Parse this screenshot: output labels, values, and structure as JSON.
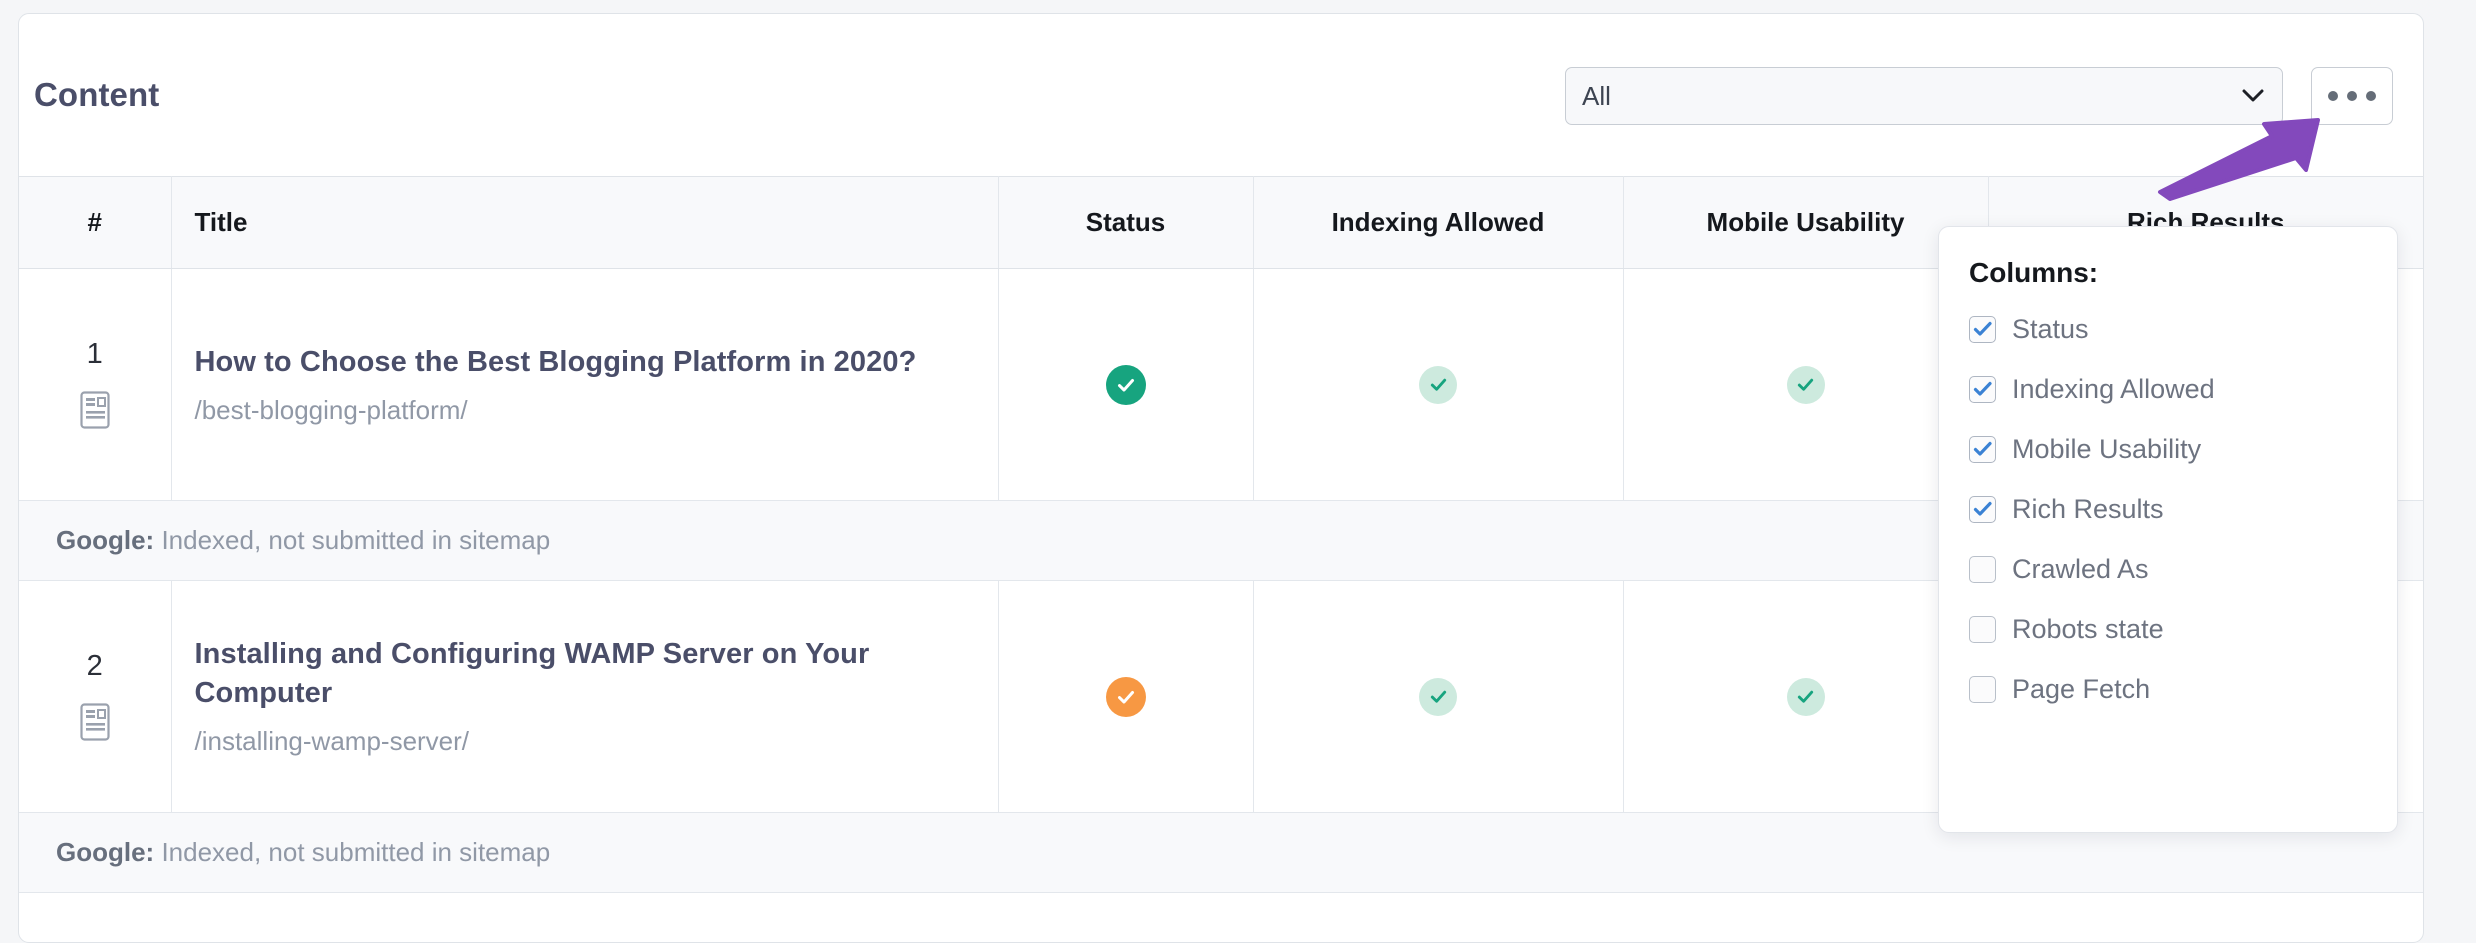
{
  "card": {
    "title": "Content",
    "filter": {
      "selected": "All",
      "chevron_icon": "chevron-down-icon"
    },
    "more_button": {
      "icon": "ellipsis-icon",
      "label": "•••"
    }
  },
  "table": {
    "headers": {
      "number": "#",
      "title": "Title",
      "status": "Status",
      "indexing_allowed": "Indexing Allowed",
      "mobile_usability": "Mobile Usability",
      "rich_results": "Rich Results"
    },
    "rows": [
      {
        "number": "1",
        "type_icon": "article-icon",
        "title": "How to Choose the Best Blogging Platform in 2020?",
        "url": "/best-blogging-platform/",
        "status_icon": "check-circle-solid-green",
        "indexing_icon": "check-circle-soft-green",
        "mobile_icon": "check-circle-soft-green",
        "note_label": "Google:",
        "note_text": " Indexed, not submitted in sitemap"
      },
      {
        "number": "2",
        "type_icon": "article-icon",
        "title": "Installing and Configuring WAMP Server on Your Computer",
        "url": "/installing-wamp-server/",
        "status_icon": "check-circle-solid-orange",
        "indexing_icon": "check-circle-soft-green",
        "mobile_icon": "check-circle-soft-green",
        "note_label": "Google:",
        "note_text": " Indexed, not submitted in sitemap"
      }
    ]
  },
  "columns_panel": {
    "title": "Columns:",
    "options": [
      {
        "label": "Status",
        "checked": true
      },
      {
        "label": "Indexing Allowed",
        "checked": true
      },
      {
        "label": "Mobile Usability",
        "checked": true
      },
      {
        "label": "Rich Results",
        "checked": true
      },
      {
        "label": "Crawled As",
        "checked": false
      },
      {
        "label": "Robots state",
        "checked": false
      },
      {
        "label": "Page Fetch",
        "checked": false
      }
    ]
  },
  "annotation": {
    "arrow_icon": "arrow-up-right-annotation",
    "color": "#8349bc"
  },
  "colors": {
    "status_green": "#17a47f",
    "status_green_soft_bg": "#cdeade",
    "status_green_soft_fg": "#17a47f",
    "status_orange": "#f79843",
    "checkbox_blue": "#3b82d4",
    "title_text": "#4a4e69",
    "muted_text": "#9098a6",
    "page_bg": "#f5f6f8",
    "card_border": "#dfe3e8"
  }
}
